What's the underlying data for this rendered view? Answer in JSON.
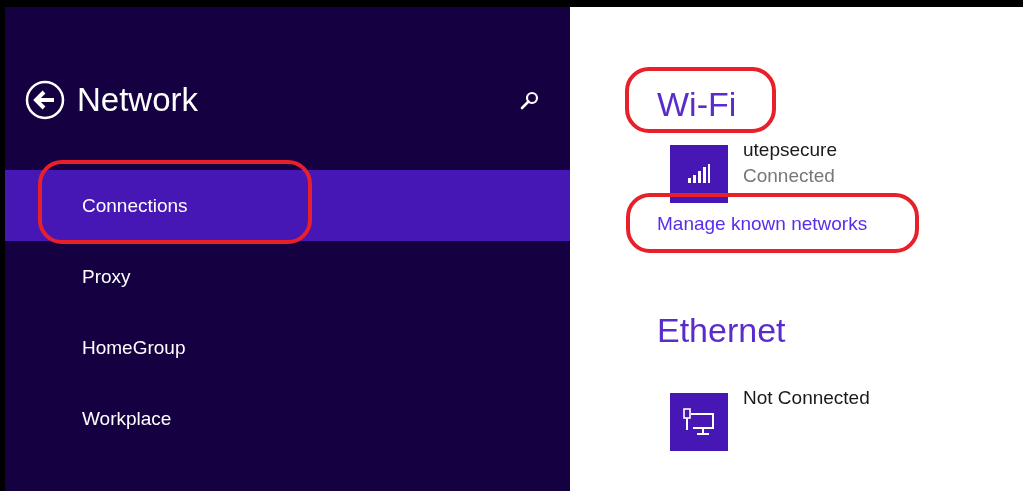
{
  "sidebar": {
    "title": "Network",
    "items": [
      {
        "label": "Connections",
        "selected": true,
        "highlighted": true
      },
      {
        "label": "Proxy",
        "selected": false,
        "highlighted": false
      },
      {
        "label": "HomeGroup",
        "selected": false,
        "highlighted": false
      },
      {
        "label": "Workplace",
        "selected": false,
        "highlighted": false
      }
    ]
  },
  "sections": [
    {
      "heading": "Wi-Fi",
      "highlighted": true,
      "connections": [
        {
          "kind": "wifi",
          "name": "utepsecure",
          "status": "Connected"
        }
      ],
      "link": {
        "label": "Manage known networks",
        "highlighted": true
      }
    },
    {
      "heading": "Ethernet",
      "highlighted": false,
      "connections": [
        {
          "kind": "ethernet",
          "status": "Not Connected"
        }
      ]
    }
  ]
}
